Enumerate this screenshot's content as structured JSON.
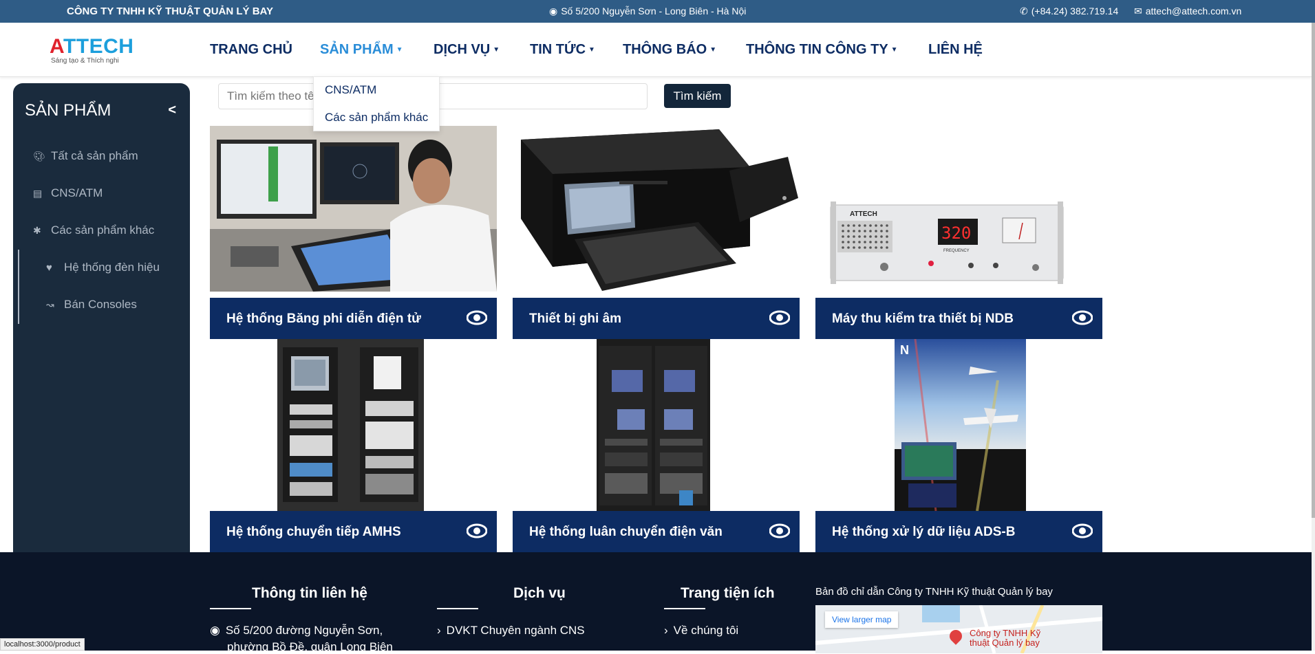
{
  "topbar": {
    "company": "CÔNG TY TNHH KỸ THUẬT QUẢN LÝ BAY",
    "address": "Số 5/200 Nguyễn Sơn - Long Biên - Hà Nội",
    "phone": "(+84.24) 382.719.14",
    "email": "attech@attech.com.vn"
  },
  "logo": {
    "brand_first": "A",
    "brand_rest": "TTECH",
    "slogan": "Sáng tạo & Thích nghi"
  },
  "nav": {
    "home": "TRANG CHỦ",
    "products": "SẢN PHẨM",
    "services": "DỊCH VỤ",
    "news": "TIN TỨC",
    "notices": "THÔNG BÁO",
    "company_info": "THÔNG TIN CÔNG TY",
    "contact": "LIÊN HỆ"
  },
  "dropdown": {
    "items": [
      "CNS/ATM",
      "Các sản phẩm khác"
    ]
  },
  "sidebar": {
    "title": "SẢN PHẨM",
    "collapse": "<",
    "items": [
      "Tất cả sản phẩm",
      "CNS/ATM",
      "Các sản phẩm khác"
    ],
    "sub_items": [
      "Hệ thống đèn hiệu",
      "Bán Consoles"
    ]
  },
  "search": {
    "placeholder": "Tìm kiếm theo tên sản phẩm",
    "button": "Tìm kiếm"
  },
  "products": [
    "Hệ thống Băng phi diễn điện tử",
    "Thiết bị ghi âm",
    "Máy thu kiểm tra thiết bị NDB",
    "Hệ thống chuyển tiếp AMHS",
    "Hệ thống luân chuyển điện văn",
    "Hệ thống xử lý dữ liệu ADS-B"
  ],
  "ndb_device": {
    "brand": "ATTECH",
    "display": "320",
    "freq_label": "FREQUENCY"
  },
  "footer": {
    "contact_head": "Thông tin liên hệ",
    "contact_line1": "Số 5/200 đường Nguyễn Sơn,",
    "contact_line2": "phường Bồ Đề, quận Long Biên",
    "services_head": "Dịch vụ",
    "services_item": "DVKT Chuyên ngành CNS",
    "utility_head": "Trang tiện ích",
    "utility_item": "Về chúng tôi",
    "map_label": "Bản đồ chỉ dẫn Công ty TNHH Kỹ thuật Quản lý bay",
    "map_larger": "View larger map",
    "map_place_1": "Công ty TNHH Kỹ",
    "map_place_2": "thuật Quản lý bay"
  },
  "status_url": "localhost:3000/product",
  "colors": {
    "topbar": "#2f5c86",
    "navy": "#0d2c63",
    "sidebar": "#1a2b3d",
    "footer": "#0b1528",
    "accent": "#2a8dd8"
  }
}
